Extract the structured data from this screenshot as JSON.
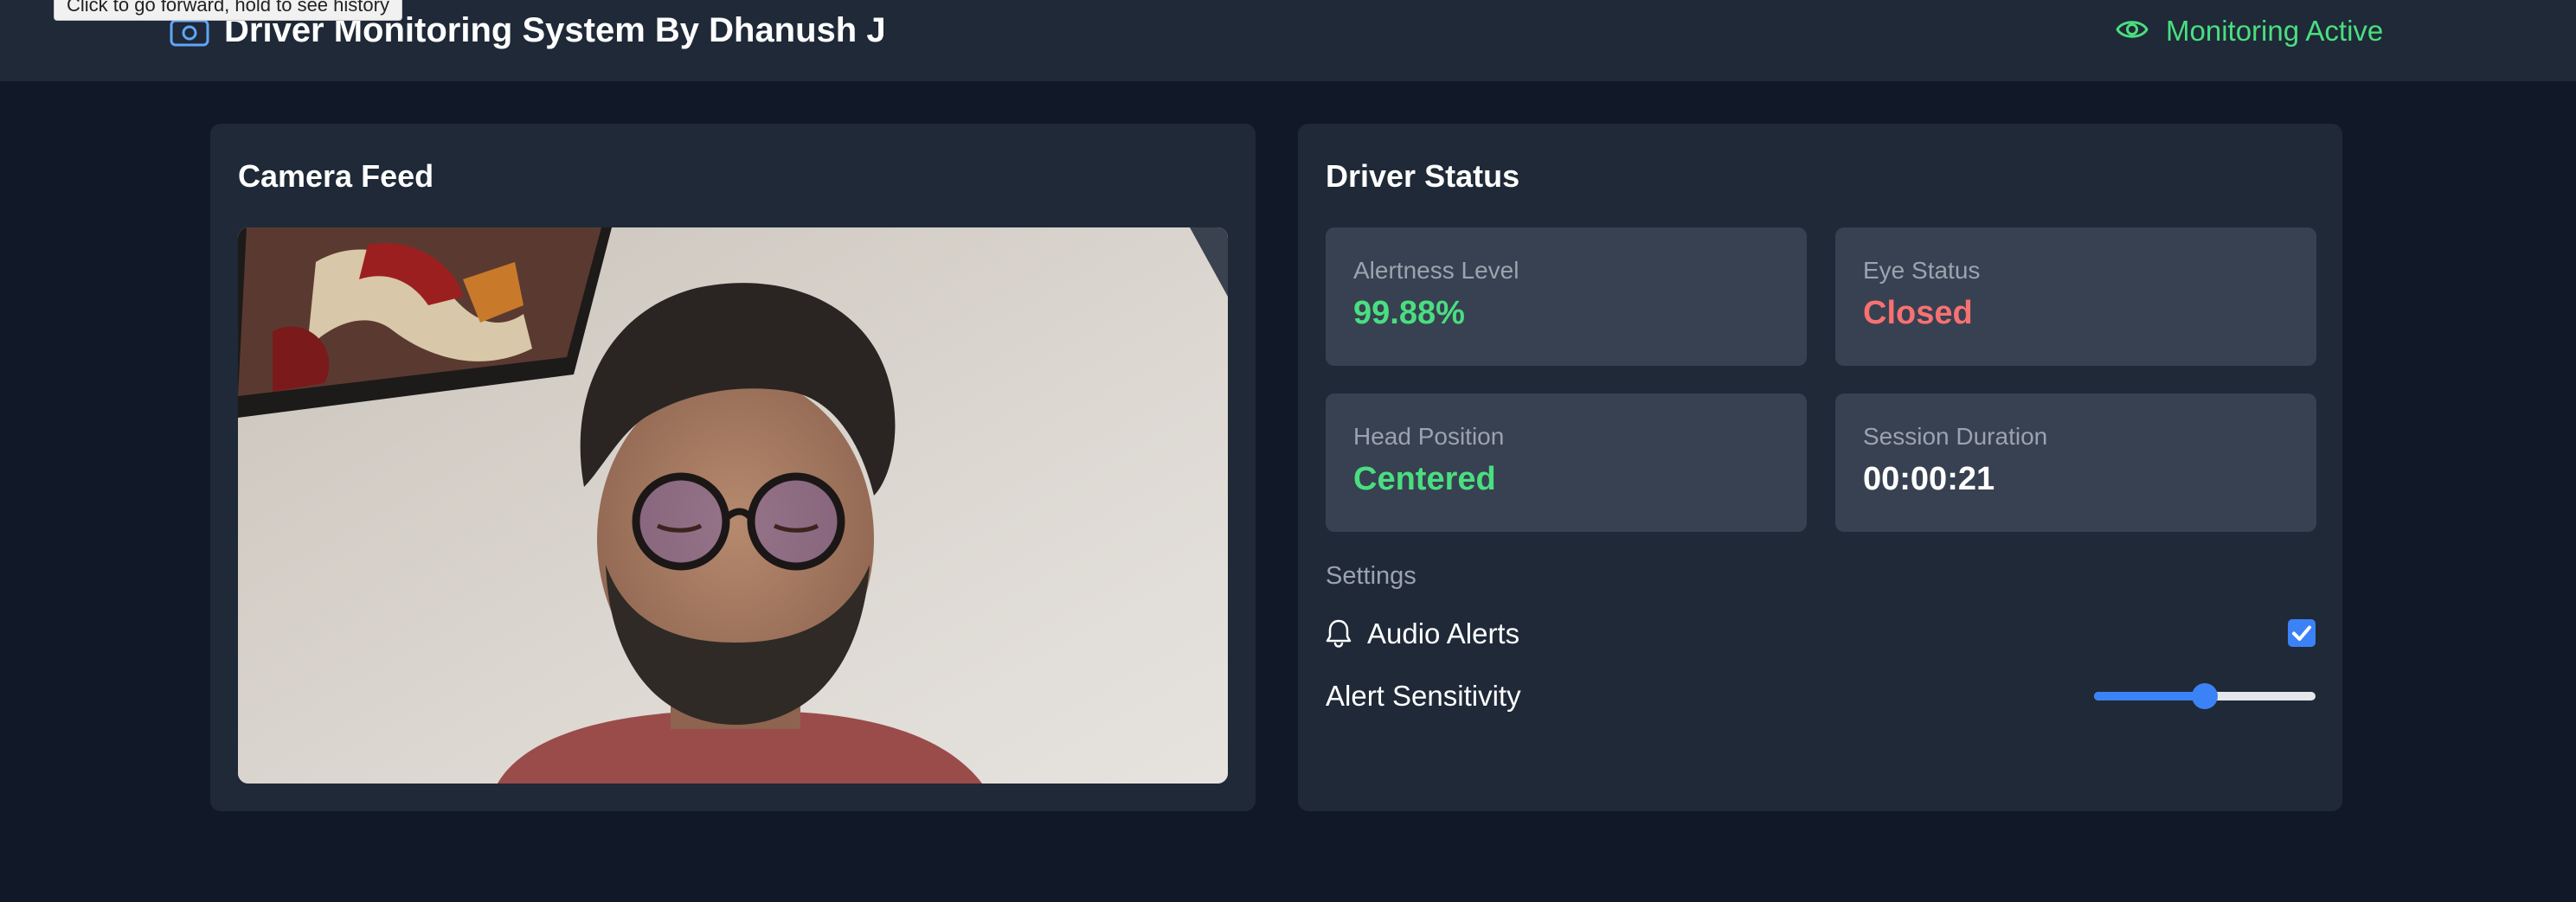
{
  "browser": {
    "tooltip": "Click to go forward, hold to see history"
  },
  "header": {
    "title": "Driver Monitoring System By Dhanush J",
    "app_icon": "camera-icon",
    "status_icon": "eye-icon",
    "status_label": "Monitoring Active"
  },
  "camera_panel": {
    "title": "Camera Feed"
  },
  "status_panel": {
    "title": "Driver Status",
    "stats": [
      {
        "label": "Alertness Level",
        "value": "99.88%",
        "color": "#4ade80"
      },
      {
        "label": "Eye Status",
        "value": "Closed",
        "color": "#f87171"
      },
      {
        "label": "Head Position",
        "value": "Centered",
        "color": "#4ade80"
      },
      {
        "label": "Session Duration",
        "value": "00:00:21",
        "color": "#ffffff"
      }
    ],
    "settings": {
      "heading": "Settings",
      "audio_alerts_label": "Audio Alerts",
      "audio_alerts_icon": "bell-icon",
      "audio_alerts_enabled": true,
      "sensitivity_label": "Alert Sensitivity",
      "sensitivity_fraction": 0.5
    }
  },
  "colors": {
    "page_background": "#111827",
    "panel_background": "#1f2937",
    "card_background": "#374151",
    "accent": "#3b82f6",
    "success": "#4ade80",
    "danger": "#f87171"
  }
}
